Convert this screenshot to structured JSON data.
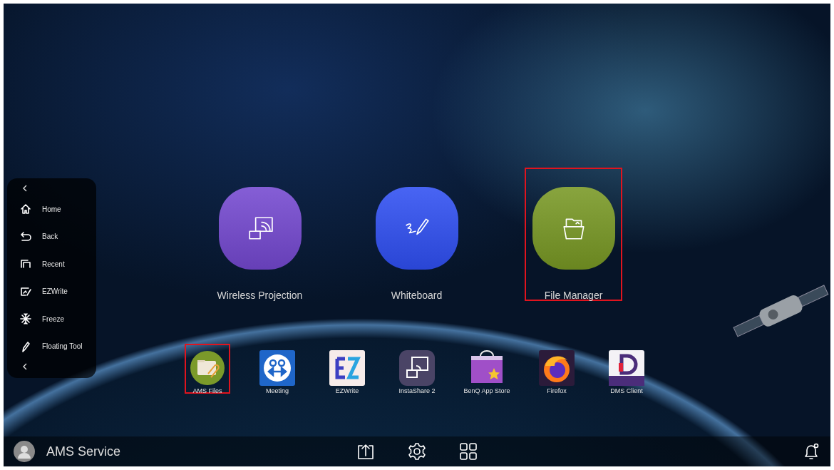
{
  "side_menu": {
    "items": [
      {
        "label": "Home",
        "kind": "home"
      },
      {
        "label": "Back",
        "kind": "back"
      },
      {
        "label": "Recent",
        "kind": "recent"
      },
      {
        "label": "EZWrite",
        "kind": "ezwrite"
      },
      {
        "label": "Freeze",
        "kind": "freeze"
      },
      {
        "label": "Floating Tool",
        "kind": "pen"
      }
    ]
  },
  "apps": [
    {
      "label": "Wireless Projection",
      "kind": "projection",
      "color": "#7448d0",
      "highlighted": false
    },
    {
      "label": "Whiteboard",
      "kind": "whiteboard",
      "color": "#2f4ff2",
      "highlighted": false
    },
    {
      "label": "File Manager",
      "kind": "folder",
      "color": "#789824",
      "highlighted": true
    }
  ],
  "dock": [
    {
      "label": "AMS Files",
      "kind": "amsfiles",
      "highlighted": true
    },
    {
      "label": "Meeting",
      "kind": "meeting",
      "highlighted": false
    },
    {
      "label": "EZWrite",
      "kind": "ezwrite",
      "highlighted": false
    },
    {
      "label": "InstaShare 2",
      "kind": "instashare",
      "highlighted": false
    },
    {
      "label": "BenQ App Store",
      "kind": "store",
      "highlighted": false
    },
    {
      "label": "Firefox",
      "kind": "firefox",
      "highlighted": false
    },
    {
      "label": "DMS Client",
      "kind": "dms",
      "highlighted": false
    }
  ],
  "taskbar": {
    "user": "AMS Service"
  }
}
